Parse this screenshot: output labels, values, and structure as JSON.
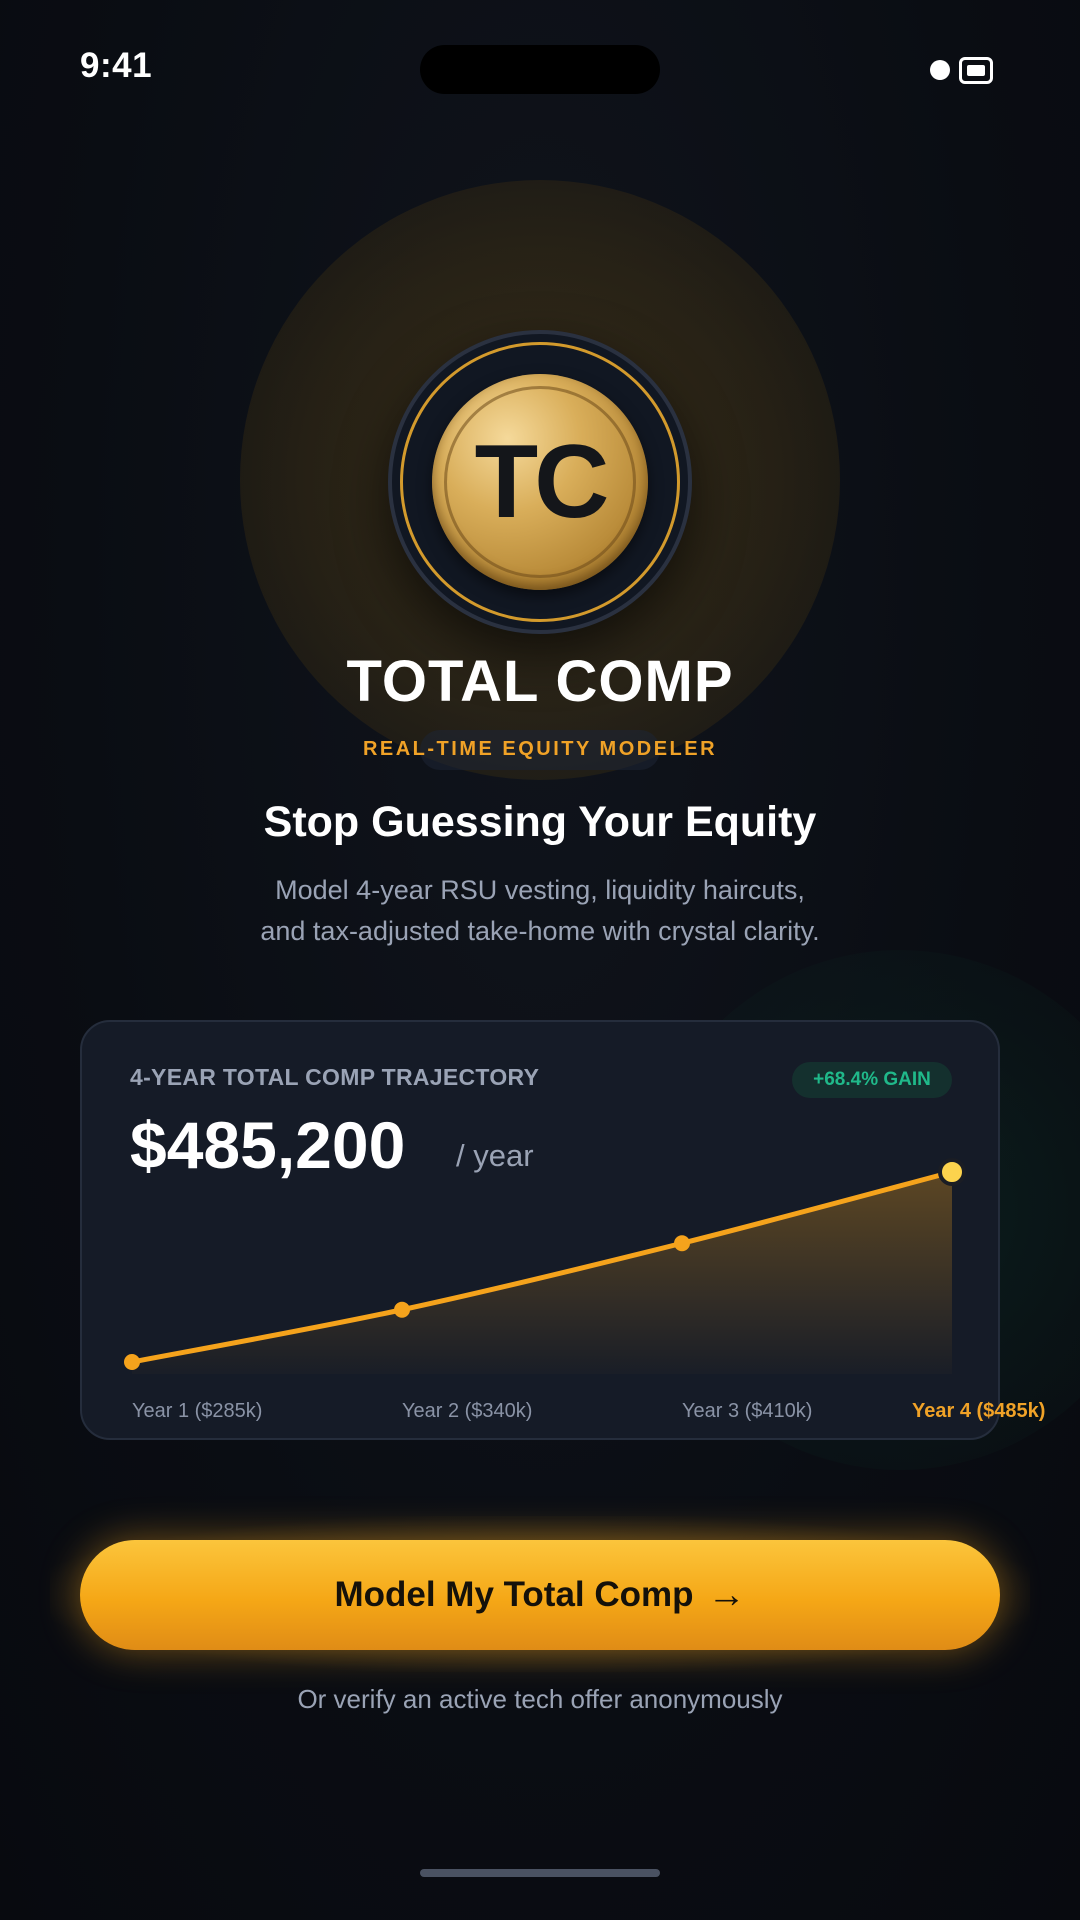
{
  "status_bar": {
    "time": "9:41"
  },
  "brand": {
    "logo_letters": "TC",
    "title": "TOTAL COMP",
    "tagline": "REAL-TIME EQUITY MODELER"
  },
  "hero": {
    "headline": "Stop Guessing Your Equity",
    "subtext_line1": "Model 4-year RSU vesting, liquidity haircuts,",
    "subtext_line2": "and tax-adjusted take-home with crystal clarity."
  },
  "card": {
    "label": "4-YEAR TOTAL COMP TRAJECTORY",
    "gain_badge": "+68.4% GAIN",
    "value": "$485,200",
    "unit": "/ year"
  },
  "chart_data": {
    "type": "area",
    "categories": [
      "Year 1 ($285k)",
      "Year 2 ($340k)",
      "Year 3 ($410k)",
      "Year 4 ($485k)"
    ],
    "values": [
      285,
      340,
      410,
      485
    ],
    "highlight_index": 3,
    "line_color": "#f5a31c",
    "highlight_point_color": "#fcd34d"
  },
  "cta": {
    "primary_label": "Model My Total Comp",
    "primary_arrow": "→",
    "secondary_label": "Or verify an active tech offer anonymously"
  },
  "colors": {
    "accent": "#f0a227",
    "gain": "#20b98a",
    "background": "#0a0d13",
    "card": "#151b27"
  }
}
